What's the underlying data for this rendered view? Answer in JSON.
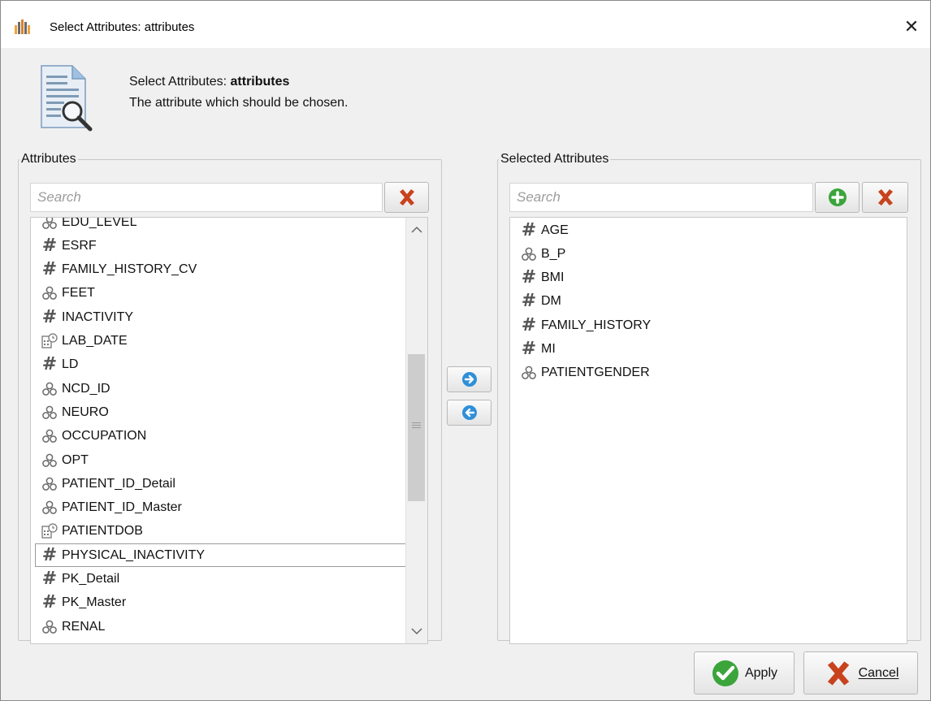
{
  "window": {
    "title": "Select Attributes: attributes",
    "close_label": "✕"
  },
  "header": {
    "title_prefix": "Select Attributes: ",
    "title_bold": "attributes",
    "description": "The attribute which should be chosen."
  },
  "left_panel": {
    "legend": "Attributes",
    "search_placeholder": "Search",
    "items": [
      {
        "label": "EDU_LEVEL",
        "type": "nominal"
      },
      {
        "label": "ESRF",
        "type": "numeric"
      },
      {
        "label": "FAMILY_HISTORY_CV",
        "type": "numeric"
      },
      {
        "label": "FEET",
        "type": "nominal"
      },
      {
        "label": "INACTIVITY",
        "type": "numeric"
      },
      {
        "label": "LAB_DATE",
        "type": "date"
      },
      {
        "label": "LD",
        "type": "numeric"
      },
      {
        "label": "NCD_ID",
        "type": "nominal"
      },
      {
        "label": "NEURO",
        "type": "nominal"
      },
      {
        "label": "OCCUPATION",
        "type": "nominal"
      },
      {
        "label": "OPT",
        "type": "nominal"
      },
      {
        "label": "PATIENT_ID_Detail",
        "type": "nominal"
      },
      {
        "label": "PATIENT_ID_Master",
        "type": "nominal"
      },
      {
        "label": "PATIENTDOB",
        "type": "date"
      },
      {
        "label": "PHYSICAL_INACTIVITY",
        "type": "numeric",
        "selected": true
      },
      {
        "label": "PK_Detail",
        "type": "numeric"
      },
      {
        "label": "PK_Master",
        "type": "numeric"
      },
      {
        "label": "RENAL",
        "type": "nominal"
      }
    ]
  },
  "right_panel": {
    "legend": "Selected Attributes",
    "search_placeholder": "Search",
    "items": [
      {
        "label": "AGE",
        "type": "numeric"
      },
      {
        "label": "B_P",
        "type": "nominal"
      },
      {
        "label": "BMI",
        "type": "numeric"
      },
      {
        "label": "DM",
        "type": "numeric"
      },
      {
        "label": "FAMILY_HISTORY",
        "type": "numeric"
      },
      {
        "label": "MI",
        "type": "numeric"
      },
      {
        "label": "PATIENTGENDER",
        "type": "nominal"
      }
    ]
  },
  "footer": {
    "apply_label": "Apply",
    "cancel_label": "Cancel"
  },
  "colors": {
    "red_x": "#c8421d",
    "green": "#3ba53b",
    "blue": "#2f8fd8"
  }
}
